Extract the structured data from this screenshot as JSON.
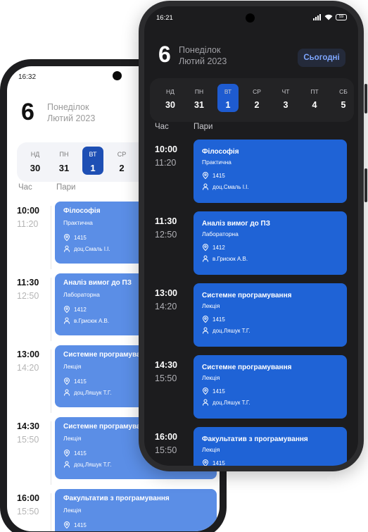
{
  "light": {
    "status_time": "16:32",
    "day_number": "6",
    "weekday": "Понеділок",
    "month_year": "Лютий 2023",
    "week": [
      {
        "name": "НД",
        "date": "30"
      },
      {
        "name": "ПН",
        "date": "31"
      },
      {
        "name": "ВТ",
        "date": "1"
      },
      {
        "name": "СР",
        "date": "2"
      }
    ],
    "headers": {
      "time": "Час",
      "pairs": "Пари"
    },
    "lessons": [
      {
        "start": "10:00",
        "end": "11:20",
        "title": "Філософія",
        "type": "Практична",
        "room": "1415",
        "teacher": "доц.Смаль І.І."
      },
      {
        "start": "11:30",
        "end": "12:50",
        "title": "Аналіз вимог до ПЗ",
        "type": "Лабораторна",
        "room": "1412",
        "teacher": "в.Грисюк А.В."
      },
      {
        "start": "13:00",
        "end": "14:20",
        "title": "Системне програмування",
        "type": "Лекція",
        "room": "1415",
        "teacher": "доц.Ляшук Т.Г."
      },
      {
        "start": "14:30",
        "end": "15:50",
        "title": "Системне програмування",
        "type": "Лекція",
        "room": "1415",
        "teacher": "доц.Ляшук Т.Г."
      },
      {
        "start": "16:00",
        "end": "15:50",
        "title": "Факультатив з програмування",
        "type": "Лекція",
        "room": "1415",
        "teacher": ""
      }
    ]
  },
  "dark": {
    "status_time": "16:21",
    "battery": "59",
    "day_number": "6",
    "weekday": "Понеділок",
    "month_year": "Лютий 2023",
    "today_button": "Сьогодні",
    "week": [
      {
        "name": "НД",
        "date": "30"
      },
      {
        "name": "ПН",
        "date": "31"
      },
      {
        "name": "ВТ",
        "date": "1"
      },
      {
        "name": "СР",
        "date": "2"
      },
      {
        "name": "ЧТ",
        "date": "3"
      },
      {
        "name": "ПТ",
        "date": "4"
      },
      {
        "name": "СБ",
        "date": "5"
      }
    ],
    "headers": {
      "time": "Час",
      "pairs": "Пари"
    },
    "lessons": [
      {
        "start": "10:00",
        "end": "11:20",
        "title": "Філософія",
        "type": "Практична",
        "room": "1415",
        "teacher": "доц.Смаль І.І."
      },
      {
        "start": "11:30",
        "end": "12:50",
        "title": "Аналіз вимог до ПЗ",
        "type": "Лабораторна",
        "room": "1412",
        "teacher": "в.Грисюк А.В."
      },
      {
        "start": "13:00",
        "end": "14:20",
        "title": "Системне програмування",
        "type": "Лекція",
        "room": "1415",
        "teacher": "доц.Ляшук Т.Г."
      },
      {
        "start": "14:30",
        "end": "15:50",
        "title": "Системне програмування",
        "type": "Лекція",
        "room": "1415",
        "teacher": "доц.Ляшук Т.Г."
      },
      {
        "start": "16:00",
        "end": "15:50",
        "title": "Факультатив з програмування",
        "type": "Лекція",
        "room": "1415",
        "teacher": ""
      }
    ]
  },
  "colors": {
    "light_card": "#5b8ee6",
    "dark_card": "#1f63d6",
    "active_day": "#1e5bd0",
    "today_button_text": "#7ea6ff"
  },
  "icons": [
    "location-pin-icon",
    "person-icon",
    "signal-icon",
    "wifi-icon",
    "battery-icon"
  ]
}
